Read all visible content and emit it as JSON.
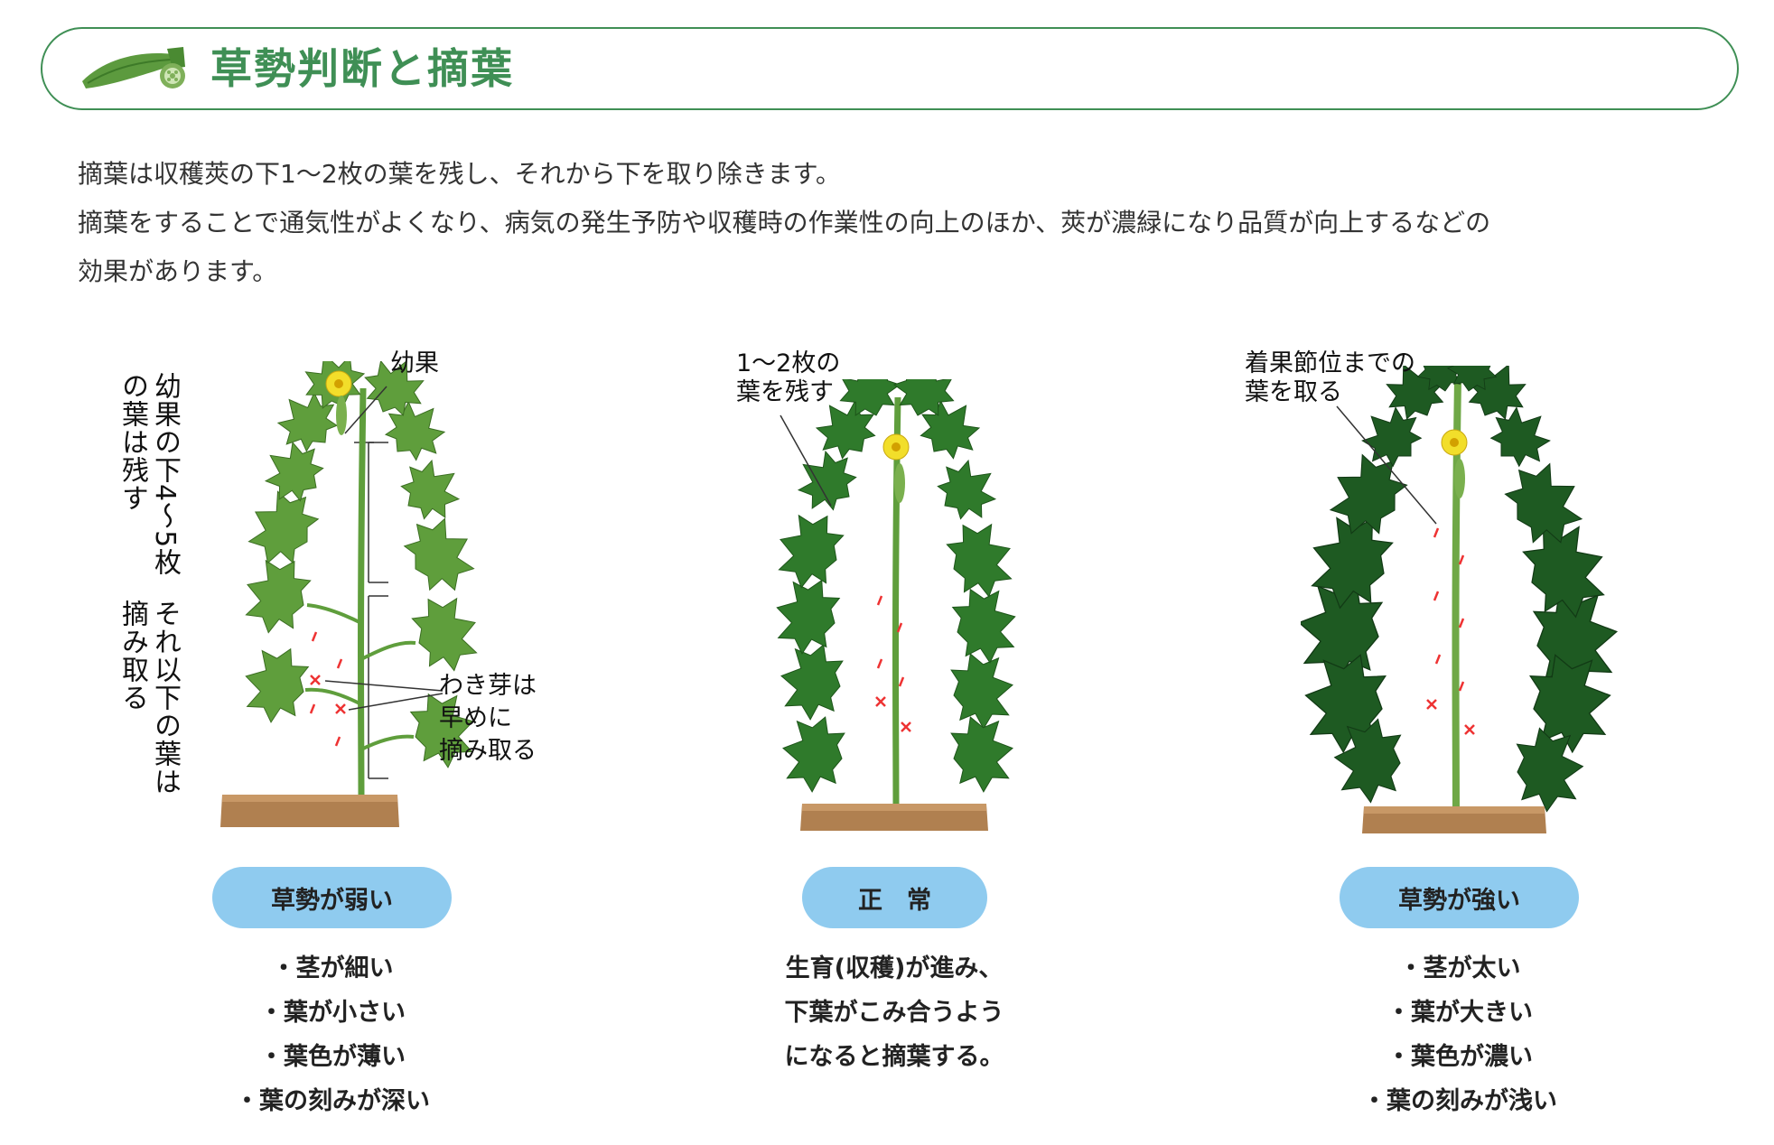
{
  "header": {
    "title": "草勢判断と摘葉",
    "logo_icon": "okra-icon",
    "accent_color": "#3f8f55"
  },
  "intro": {
    "line1": "摘葉は収穫莢の下1〜2枚の葉を残し、それから下を取り除きます。",
    "line2": "摘葉をすることで通気性がよくなり、病気の発生予防や収穫時の作業性の向上のほか、莢が濃緑になり品質が向上するなどの",
    "line3": "効果があります。"
  },
  "weak": {
    "label_upper": "幼果の下4〜5枚の葉は残す",
    "label_lower": "それ以下の葉は摘み取る",
    "anno_young_fruit": "幼果",
    "anno_side_buds": [
      "わき芽は",
      "早めに",
      "摘み取る"
    ],
    "pill": "草勢が弱い",
    "points": [
      "・茎が細い",
      "・葉が小さい",
      "・葉色が薄い",
      "・葉の刻みが深い"
    ],
    "leaf_color": "#5f9e3c"
  },
  "normal": {
    "anno": [
      "1〜2枚の",
      "葉を残す"
    ],
    "pill": "正　常",
    "points": [
      "生育(収穫)が進み、",
      "下葉がこみ合うよう",
      "になると摘葉する。"
    ],
    "leaf_color": "#2f7a2b"
  },
  "strong": {
    "anno": [
      "着果節位までの",
      "葉を取る"
    ],
    "pill": "草勢が強い",
    "points": [
      "・茎が太い",
      "・葉が大きい",
      "・葉色が濃い",
      "・葉の刻みが浅い"
    ],
    "leaf_color": "#1e5a22"
  },
  "colors": {
    "pill": "#8fcbef",
    "soil": "#b08050",
    "flower": "#f2de2a",
    "cut_mark": "#e33"
  }
}
